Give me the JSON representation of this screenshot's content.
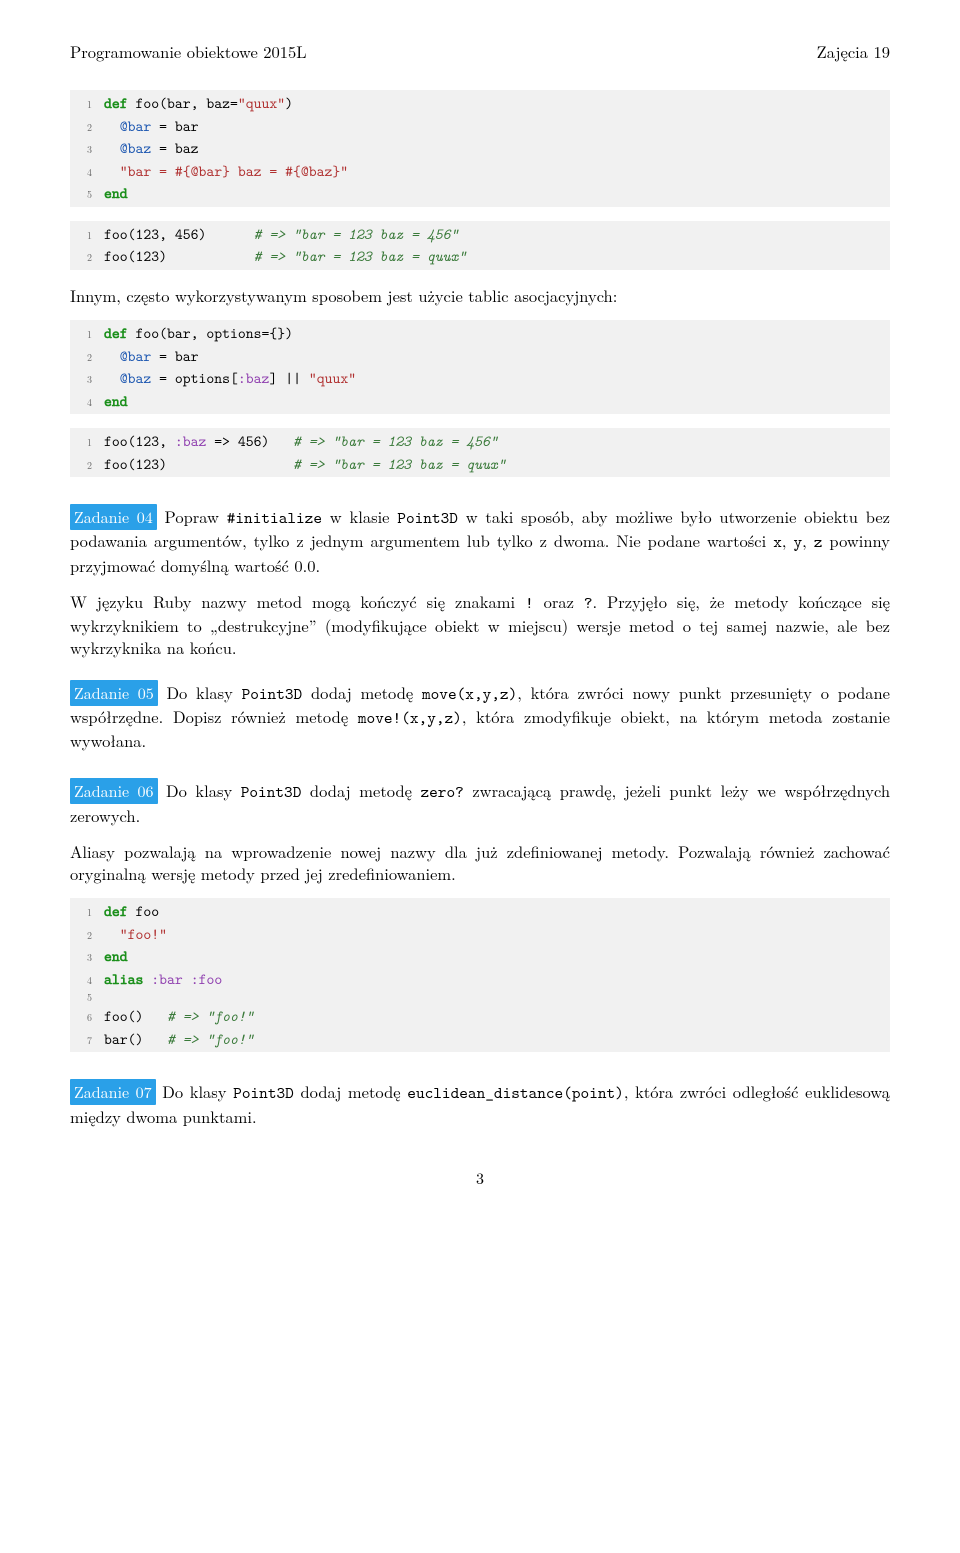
{
  "header": {
    "left": "Programowanie obiektowe 2015L",
    "right": "Zajęcia 19"
  },
  "code1": {
    "lines": [
      {
        "n": "1",
        "seg": [
          {
            "c": "kw-def",
            "t": "def"
          },
          {
            "t": " foo(bar, baz="
          },
          {
            "c": "str",
            "t": "\"quux\""
          },
          {
            "t": ")"
          }
        ]
      },
      {
        "n": "2",
        "seg": [
          {
            "t": "  "
          },
          {
            "c": "ivar",
            "t": "@bar"
          },
          {
            "t": " = bar"
          }
        ]
      },
      {
        "n": "3",
        "seg": [
          {
            "t": "  "
          },
          {
            "c": "ivar",
            "t": "@baz"
          },
          {
            "t": " = baz"
          }
        ]
      },
      {
        "n": "4",
        "seg": [
          {
            "t": "  "
          },
          {
            "c": "str",
            "t": "\"bar = #{@bar} baz = #{@baz}\""
          }
        ]
      },
      {
        "n": "5",
        "seg": [
          {
            "c": "kw-end",
            "t": "end"
          }
        ]
      }
    ]
  },
  "code2": {
    "lines": [
      {
        "n": "1",
        "seg": [
          {
            "t": "foo(123, 456)      "
          },
          {
            "c": "cmt",
            "t": "# => \"bar = 123 baz = 456\""
          }
        ]
      },
      {
        "n": "2",
        "seg": [
          {
            "t": "foo(123)           "
          },
          {
            "c": "cmt",
            "t": "# => \"bar = 123 baz = quux\""
          }
        ]
      }
    ]
  },
  "para1": "Innym, często wykorzystywanym sposobem jest użycie tablic asocjacyjnych:",
  "code3": {
    "lines": [
      {
        "n": "1",
        "seg": [
          {
            "c": "kw-def",
            "t": "def"
          },
          {
            "t": " foo(bar, options={})"
          }
        ]
      },
      {
        "n": "2",
        "seg": [
          {
            "t": "  "
          },
          {
            "c": "ivar",
            "t": "@bar"
          },
          {
            "t": " = bar"
          }
        ]
      },
      {
        "n": "3",
        "seg": [
          {
            "t": "  "
          },
          {
            "c": "ivar",
            "t": "@baz"
          },
          {
            "t": " = options["
          },
          {
            "c": "sym",
            "t": ":baz"
          },
          {
            "t": "] || "
          },
          {
            "c": "str",
            "t": "\"quux\""
          }
        ]
      },
      {
        "n": "4",
        "seg": [
          {
            "c": "kw-end",
            "t": "end"
          }
        ]
      }
    ]
  },
  "code4": {
    "lines": [
      {
        "n": "1",
        "seg": [
          {
            "t": "foo(123, "
          },
          {
            "c": "sym",
            "t": ":baz"
          },
          {
            "t": " => 456)   "
          },
          {
            "c": "cmt",
            "t": "# => \"bar = 123 baz = 456\""
          }
        ]
      },
      {
        "n": "2",
        "seg": [
          {
            "t": "foo(123)                "
          },
          {
            "c": "cmt",
            "t": "# => \"bar = 123 baz = quux\""
          }
        ]
      }
    ]
  },
  "task04": {
    "badge": "Zadanie 04",
    "text_a": " Popraw ",
    "code_a": "#initialize",
    "text_b": " w klasie ",
    "code_b": "Point3D",
    "text_c": " w taki sposób, aby możliwe było utworzenie obiektu bez podawania argumentów, tylko z jednym argumentem lub tylko z dwoma. Nie podane wartości ",
    "code_c": "x",
    "text_d": ", ",
    "code_d": "y",
    "text_e": ", ",
    "code_e": "z",
    "text_f": " powinny przyjmować domyślną wartość 0.0."
  },
  "para2a": "W języku Ruby nazwy metod mogą kończyć się znakami ",
  "para2_code1": "!",
  "para2b": " oraz ",
  "para2_code2": "?",
  "para2c": ". Przyjęło się, że metody kończące się wykrzyknikiem to „destrukcyjne” (modyfikujące obiekt w miejscu) wersje metod o tej samej nazwie, ale bez wykrzyknika na końcu.",
  "task05": {
    "badge": "Zadanie 05",
    "text_a": " Do klasy ",
    "code_a": "Point3D",
    "text_b": " dodaj metodę ",
    "code_b": "move(x,y,z)",
    "text_c": ", która zwróci nowy punkt przesunięty o podane współrzędne. Dopisz również metodę ",
    "code_c": "move!(x,y,z)",
    "text_d": ", która zmodyfikuje obiekt, na którym metoda zostanie wywołana."
  },
  "task06": {
    "badge": "Zadanie 06",
    "text_a": " Do klasy ",
    "code_a": "Point3D",
    "text_b": " dodaj metodę ",
    "code_b": "zero?",
    "text_c": " zwracającą prawdę, jeżeli punkt leży we współrzędnych zerowych."
  },
  "para3": "Aliasy pozwalają na wprowadzenie nowej nazwy dla już zdefiniowanej metody. Pozwalają również zachować oryginalną wersję metody przed jej zredefiniowaniem.",
  "code5": {
    "lines": [
      {
        "n": "1",
        "seg": [
          {
            "c": "kw-def",
            "t": "def"
          },
          {
            "t": " foo"
          }
        ]
      },
      {
        "n": "2",
        "seg": [
          {
            "t": "  "
          },
          {
            "c": "str",
            "t": "\"foo!\""
          }
        ]
      },
      {
        "n": "3",
        "seg": [
          {
            "c": "kw-end",
            "t": "end"
          }
        ]
      },
      {
        "n": "4",
        "seg": [
          {
            "c": "kw-def",
            "t": "alias"
          },
          {
            "t": " "
          },
          {
            "c": "sym",
            "t": ":bar"
          },
          {
            "t": " "
          },
          {
            "c": "sym",
            "t": ":foo"
          }
        ]
      },
      {
        "n": "5",
        "seg": [
          {
            "t": ""
          }
        ]
      },
      {
        "n": "6",
        "seg": [
          {
            "t": "foo()   "
          },
          {
            "c": "cmt",
            "t": "# => \"foo!\""
          }
        ]
      },
      {
        "n": "7",
        "seg": [
          {
            "t": "bar()   "
          },
          {
            "c": "cmt",
            "t": "# => \"foo!\""
          }
        ]
      }
    ]
  },
  "task07": {
    "badge": "Zadanie 07",
    "text_a": " Do klasy ",
    "code_a": "Point3D",
    "text_b": " dodaj metodę ",
    "code_b": "euclidean_distance(point)",
    "text_c": ", która zwróci odległość euklidesową między dwoma punktami."
  },
  "pagenum": "3"
}
